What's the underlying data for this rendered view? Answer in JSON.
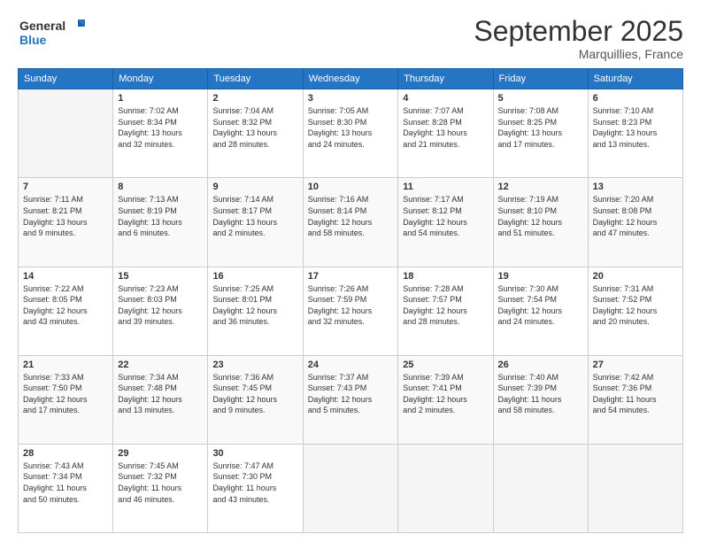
{
  "header": {
    "logo_general": "General",
    "logo_blue": "Blue",
    "month_title": "September 2025",
    "location": "Marquillies, France"
  },
  "weekdays": [
    "Sunday",
    "Monday",
    "Tuesday",
    "Wednesday",
    "Thursday",
    "Friday",
    "Saturday"
  ],
  "weeks": [
    [
      {
        "day": "",
        "detail": ""
      },
      {
        "day": "1",
        "detail": "Sunrise: 7:02 AM\nSunset: 8:34 PM\nDaylight: 13 hours\nand 32 minutes."
      },
      {
        "day": "2",
        "detail": "Sunrise: 7:04 AM\nSunset: 8:32 PM\nDaylight: 13 hours\nand 28 minutes."
      },
      {
        "day": "3",
        "detail": "Sunrise: 7:05 AM\nSunset: 8:30 PM\nDaylight: 13 hours\nand 24 minutes."
      },
      {
        "day": "4",
        "detail": "Sunrise: 7:07 AM\nSunset: 8:28 PM\nDaylight: 13 hours\nand 21 minutes."
      },
      {
        "day": "5",
        "detail": "Sunrise: 7:08 AM\nSunset: 8:25 PM\nDaylight: 13 hours\nand 17 minutes."
      },
      {
        "day": "6",
        "detail": "Sunrise: 7:10 AM\nSunset: 8:23 PM\nDaylight: 13 hours\nand 13 minutes."
      }
    ],
    [
      {
        "day": "7",
        "detail": "Sunrise: 7:11 AM\nSunset: 8:21 PM\nDaylight: 13 hours\nand 9 minutes."
      },
      {
        "day": "8",
        "detail": "Sunrise: 7:13 AM\nSunset: 8:19 PM\nDaylight: 13 hours\nand 6 minutes."
      },
      {
        "day": "9",
        "detail": "Sunrise: 7:14 AM\nSunset: 8:17 PM\nDaylight: 13 hours\nand 2 minutes."
      },
      {
        "day": "10",
        "detail": "Sunrise: 7:16 AM\nSunset: 8:14 PM\nDaylight: 12 hours\nand 58 minutes."
      },
      {
        "day": "11",
        "detail": "Sunrise: 7:17 AM\nSunset: 8:12 PM\nDaylight: 12 hours\nand 54 minutes."
      },
      {
        "day": "12",
        "detail": "Sunrise: 7:19 AM\nSunset: 8:10 PM\nDaylight: 12 hours\nand 51 minutes."
      },
      {
        "day": "13",
        "detail": "Sunrise: 7:20 AM\nSunset: 8:08 PM\nDaylight: 12 hours\nand 47 minutes."
      }
    ],
    [
      {
        "day": "14",
        "detail": "Sunrise: 7:22 AM\nSunset: 8:05 PM\nDaylight: 12 hours\nand 43 minutes."
      },
      {
        "day": "15",
        "detail": "Sunrise: 7:23 AM\nSunset: 8:03 PM\nDaylight: 12 hours\nand 39 minutes."
      },
      {
        "day": "16",
        "detail": "Sunrise: 7:25 AM\nSunset: 8:01 PM\nDaylight: 12 hours\nand 36 minutes."
      },
      {
        "day": "17",
        "detail": "Sunrise: 7:26 AM\nSunset: 7:59 PM\nDaylight: 12 hours\nand 32 minutes."
      },
      {
        "day": "18",
        "detail": "Sunrise: 7:28 AM\nSunset: 7:57 PM\nDaylight: 12 hours\nand 28 minutes."
      },
      {
        "day": "19",
        "detail": "Sunrise: 7:30 AM\nSunset: 7:54 PM\nDaylight: 12 hours\nand 24 minutes."
      },
      {
        "day": "20",
        "detail": "Sunrise: 7:31 AM\nSunset: 7:52 PM\nDaylight: 12 hours\nand 20 minutes."
      }
    ],
    [
      {
        "day": "21",
        "detail": "Sunrise: 7:33 AM\nSunset: 7:50 PM\nDaylight: 12 hours\nand 17 minutes."
      },
      {
        "day": "22",
        "detail": "Sunrise: 7:34 AM\nSunset: 7:48 PM\nDaylight: 12 hours\nand 13 minutes."
      },
      {
        "day": "23",
        "detail": "Sunrise: 7:36 AM\nSunset: 7:45 PM\nDaylight: 12 hours\nand 9 minutes."
      },
      {
        "day": "24",
        "detail": "Sunrise: 7:37 AM\nSunset: 7:43 PM\nDaylight: 12 hours\nand 5 minutes."
      },
      {
        "day": "25",
        "detail": "Sunrise: 7:39 AM\nSunset: 7:41 PM\nDaylight: 12 hours\nand 2 minutes."
      },
      {
        "day": "26",
        "detail": "Sunrise: 7:40 AM\nSunset: 7:39 PM\nDaylight: 11 hours\nand 58 minutes."
      },
      {
        "day": "27",
        "detail": "Sunrise: 7:42 AM\nSunset: 7:36 PM\nDaylight: 11 hours\nand 54 minutes."
      }
    ],
    [
      {
        "day": "28",
        "detail": "Sunrise: 7:43 AM\nSunset: 7:34 PM\nDaylight: 11 hours\nand 50 minutes."
      },
      {
        "day": "29",
        "detail": "Sunrise: 7:45 AM\nSunset: 7:32 PM\nDaylight: 11 hours\nand 46 minutes."
      },
      {
        "day": "30",
        "detail": "Sunrise: 7:47 AM\nSunset: 7:30 PM\nDaylight: 11 hours\nand 43 minutes."
      },
      {
        "day": "",
        "detail": ""
      },
      {
        "day": "",
        "detail": ""
      },
      {
        "day": "",
        "detail": ""
      },
      {
        "day": "",
        "detail": ""
      }
    ]
  ]
}
